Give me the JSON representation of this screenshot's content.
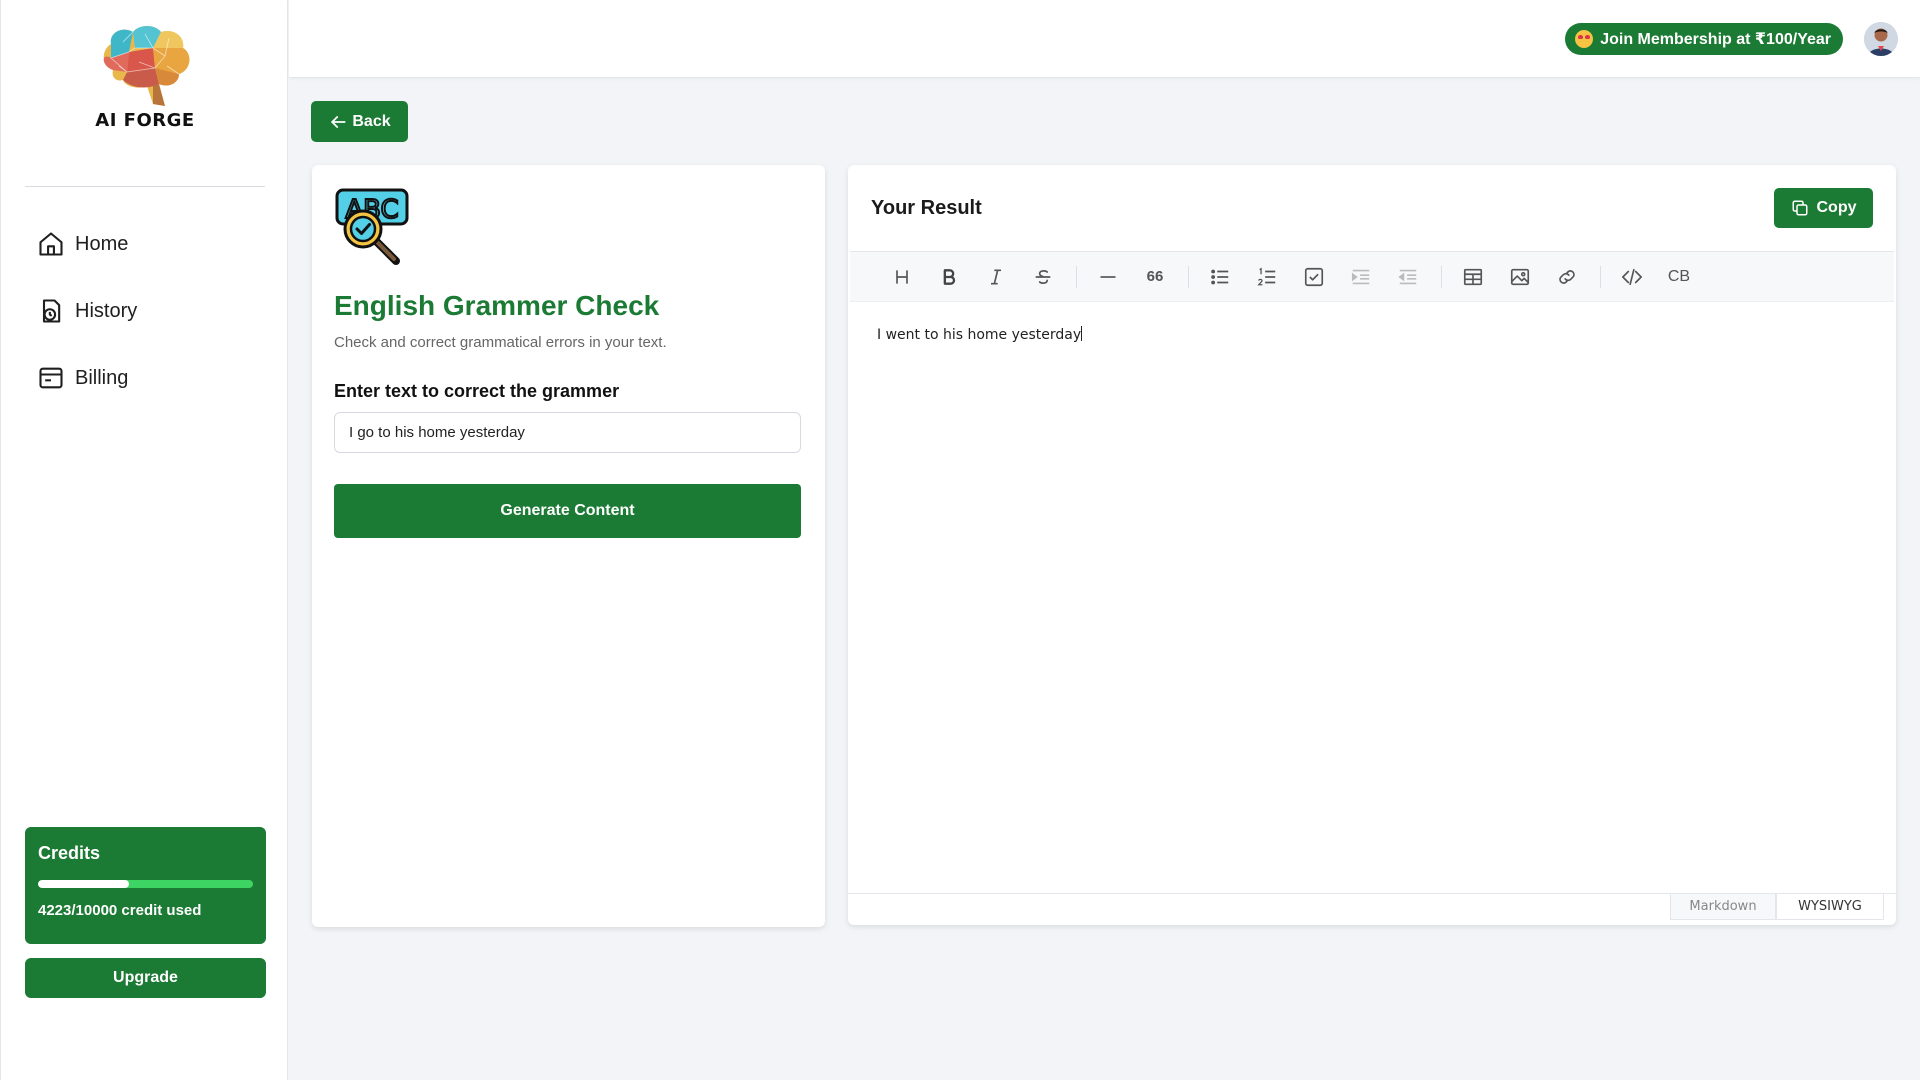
{
  "sidebar": {
    "logo_text": "AI FORGE",
    "nav": [
      {
        "label": "Home",
        "icon": "home-icon"
      },
      {
        "label": "History",
        "icon": "history-icon"
      },
      {
        "label": "Billing",
        "icon": "billing-icon"
      }
    ],
    "credits": {
      "title": "Credits",
      "used": 4223,
      "total": 10000,
      "text": "4223/10000 credit used",
      "progress": 0.4223
    },
    "upgrade_label": "Upgrade"
  },
  "topbar": {
    "membership_label": "Join Membership at ₹100/Year"
  },
  "back_label": "Back",
  "tool": {
    "title": "English Grammer Check",
    "description": "Check and correct grammatical errors in your text.",
    "input_label": "Enter text to correct the grammer",
    "input_value": "I go to his home yesterday",
    "generate_label": "Generate Content"
  },
  "result": {
    "title": "Your Result",
    "copy_label": "Copy",
    "toolbar": [
      "heading",
      "bold",
      "italic",
      "strike",
      "hr",
      "quote",
      "ul",
      "ol",
      "task",
      "indent",
      "outdent",
      "table",
      "image",
      "link",
      "code",
      "codeblock"
    ],
    "codeblock_label": "CB",
    "quote_label": "66",
    "content": "I went to his home yesterday",
    "modes": [
      "Markdown",
      "WYSIWYG"
    ]
  },
  "colors": {
    "brand_green": "#1b7a33",
    "progress_track": "#3ed463",
    "background": "#f2f4f7"
  }
}
